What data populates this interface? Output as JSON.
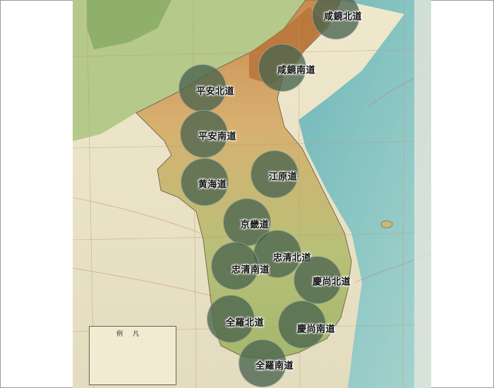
{
  "map": {
    "legend_title": "例凡",
    "provinces": [
      {
        "id": "hamgyong-north",
        "label": "咸鏡北道"
      },
      {
        "id": "hamgyong-south",
        "label": "咸鏡南道"
      },
      {
        "id": "pyongan-north",
        "label": "平安北道"
      },
      {
        "id": "pyongan-south",
        "label": "平安南道"
      },
      {
        "id": "hwanghae",
        "label": "黄海道"
      },
      {
        "id": "gangwon",
        "label": "江原道"
      },
      {
        "id": "gyeonggi",
        "label": "京畿道"
      },
      {
        "id": "chungcheong-north",
        "label": "忠清北道"
      },
      {
        "id": "chungcheong-south",
        "label": "忠清南道"
      },
      {
        "id": "gyeongsang-north",
        "label": "慶尚北道"
      },
      {
        "id": "jeolla-north",
        "label": "全羅北道"
      },
      {
        "id": "gyeongsang-south",
        "label": "慶尚南道"
      },
      {
        "id": "jeolla-south",
        "label": "全羅南道"
      }
    ]
  }
}
